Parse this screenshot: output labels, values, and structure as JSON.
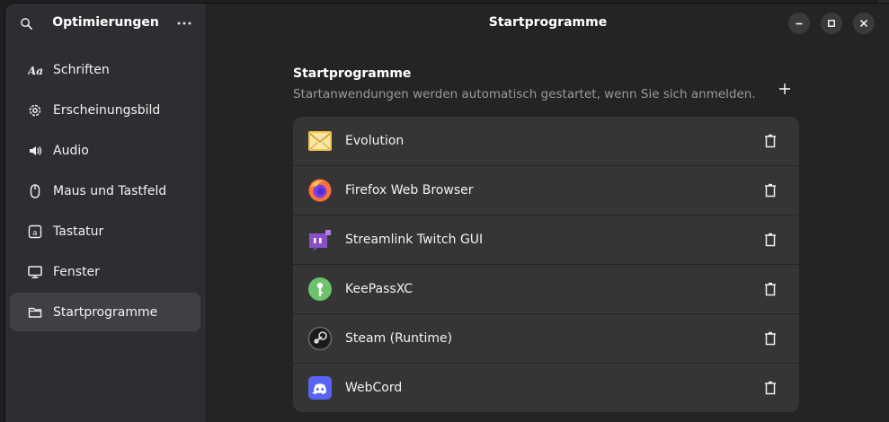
{
  "sidebar": {
    "title": "Optimierungen",
    "items": [
      {
        "label": "Schriften",
        "icon": "font-icon"
      },
      {
        "label": "Erscheinungsbild",
        "icon": "gear-icon"
      },
      {
        "label": "Audio",
        "icon": "speaker-icon"
      },
      {
        "label": "Maus und Tastfeld",
        "icon": "mouse-icon"
      },
      {
        "label": "Tastatur",
        "icon": "keyboard-icon"
      },
      {
        "label": "Fenster",
        "icon": "monitor-icon"
      },
      {
        "label": "Startprogramme",
        "icon": "folder-icon",
        "active": true
      }
    ]
  },
  "main": {
    "title": "Startprogramme",
    "section_heading": "Startprogramme",
    "section_subtitle": "Startanwendungen werden automatisch gestartet, wenn Sie sich anmelden.",
    "apps": [
      {
        "name": "Evolution",
        "icon": "envelope-icon"
      },
      {
        "name": "Firefox Web Browser",
        "icon": "firefox-icon"
      },
      {
        "name": "Streamlink Twitch GUI",
        "icon": "twitch-icon"
      },
      {
        "name": "KeePassXC",
        "icon": "keepass-icon"
      },
      {
        "name": "Steam (Runtime)",
        "icon": "steam-icon"
      },
      {
        "name": "WebCord",
        "icon": "discord-icon"
      }
    ]
  },
  "colors": {
    "sidebar_bg": "#2e2e32",
    "main_bg": "#242424",
    "list_bg": "#353535",
    "active_item": "#404044"
  }
}
